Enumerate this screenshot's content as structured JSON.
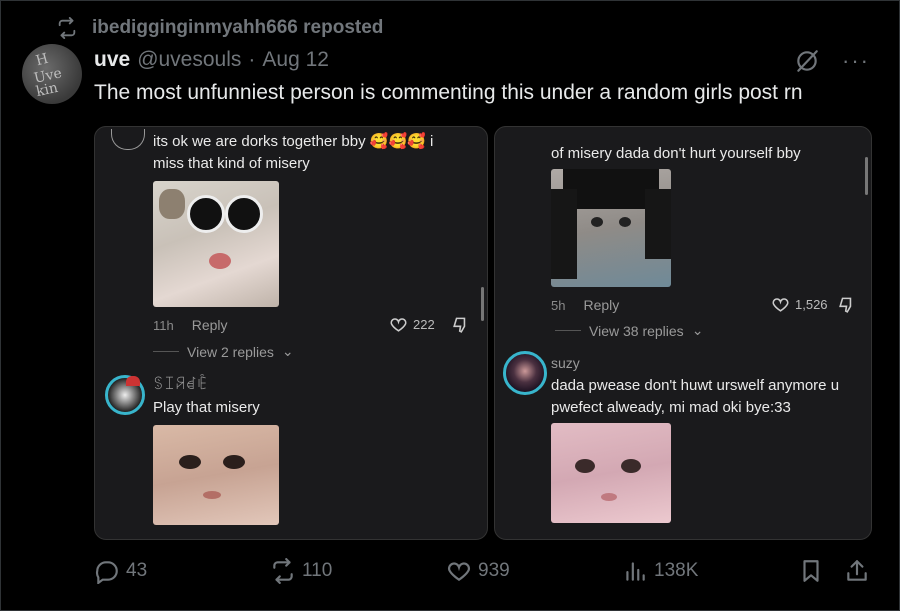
{
  "repost": {
    "text": "ibedigginginmyahh666 reposted",
    "icon": "repost-icon"
  },
  "post": {
    "display_name": "uve",
    "handle": "@uvesouls",
    "separator": "·",
    "date": "Aug 12",
    "avatar_text": [
      "Uve",
      "kin",
      "H"
    ],
    "text": "The most unfunniest person is commenting this under a random girls post rn",
    "more": "···"
  },
  "left_panel": {
    "comment1_text_a": "its ok we are dorks together bby 🥰🥰🥰 i",
    "comment1_text_b": "miss that kind of misery",
    "comment1_time": "11h",
    "comment1_reply": "Reply",
    "comment1_likes": "222",
    "comment1_view_replies": "View 2 replies",
    "comment2_user": "ꌗꀤꋪꀸꍟ",
    "comment2_text": "Play that misery"
  },
  "right_panel": {
    "comment1_text": "of misery dada don't hurt yourself bby",
    "comment1_time": "5h",
    "comment1_reply": "Reply",
    "comment1_likes": "1,526",
    "comment1_view_replies": "View 38 replies",
    "comment2_user": "suzy",
    "comment2_text_a": "dada pwease don't huwt urswelf anymore u",
    "comment2_text_b": "pwefect alweady, mi mad oki bye:33"
  },
  "actions": {
    "replies": "43",
    "reposts": "110",
    "likes": "939",
    "views": "138K"
  },
  "colors": {
    "background": "#000000",
    "muted": "#71767b",
    "text": "#e7e9ea",
    "avatar_ring": "#38b5cc"
  }
}
